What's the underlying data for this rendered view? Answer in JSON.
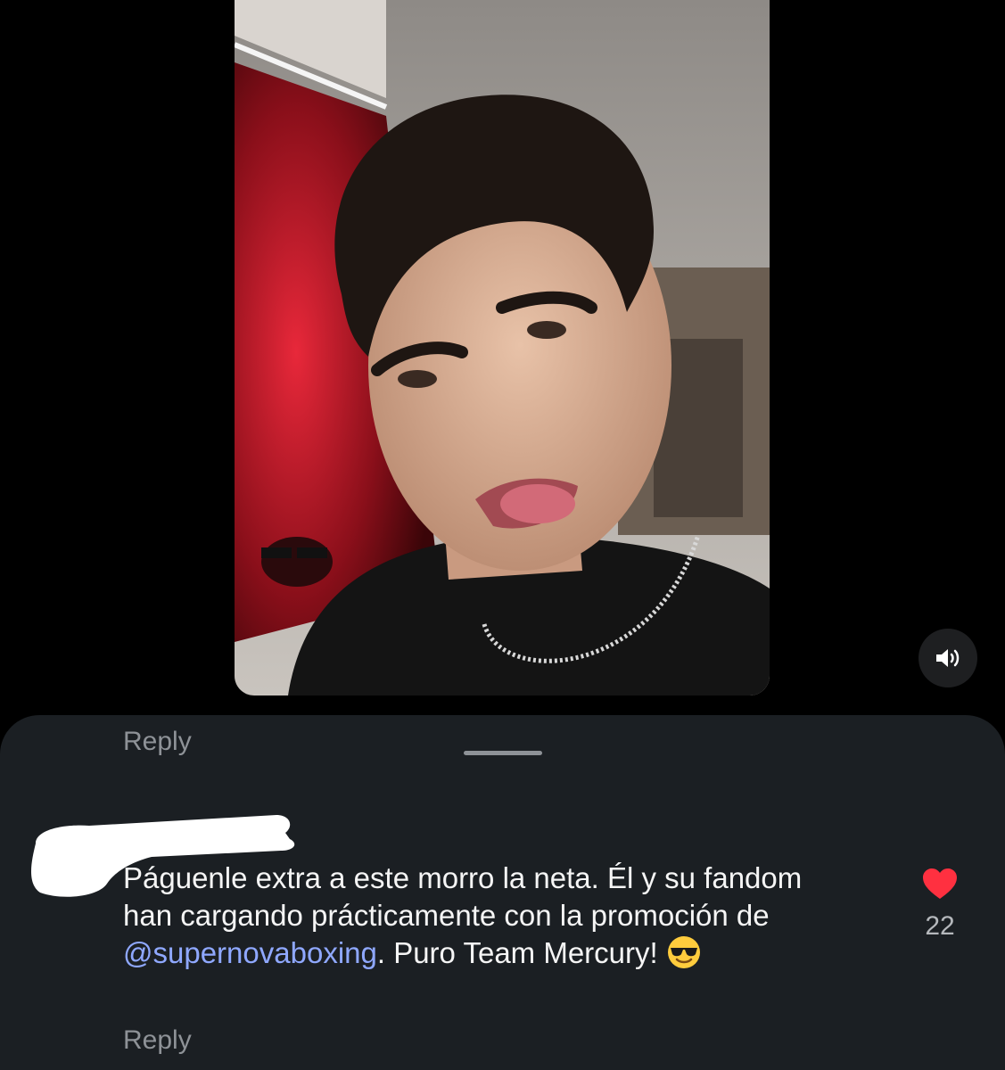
{
  "video": {
    "sound_icon": "speaker-volume-icon"
  },
  "comments": {
    "top_reply_label": "Reply",
    "comment": {
      "text_before": "Páguenle extra a este morro la neta. Él y su fandom han cargando prácticamente con la promoción de ",
      "mention": "@supernovaboxing",
      "text_after": ". Puro Team Mercury! ",
      "emoji": "smiling-face-with-sunglasses",
      "reply_label": "Reply",
      "like_count": "22",
      "like_icon": "heart-icon",
      "like_color": "#ff3040"
    }
  },
  "colors": {
    "background": "#000000",
    "sheet": "#1b1f23",
    "mention": "#8fa8ff",
    "secondary_text": "#8e9297"
  }
}
